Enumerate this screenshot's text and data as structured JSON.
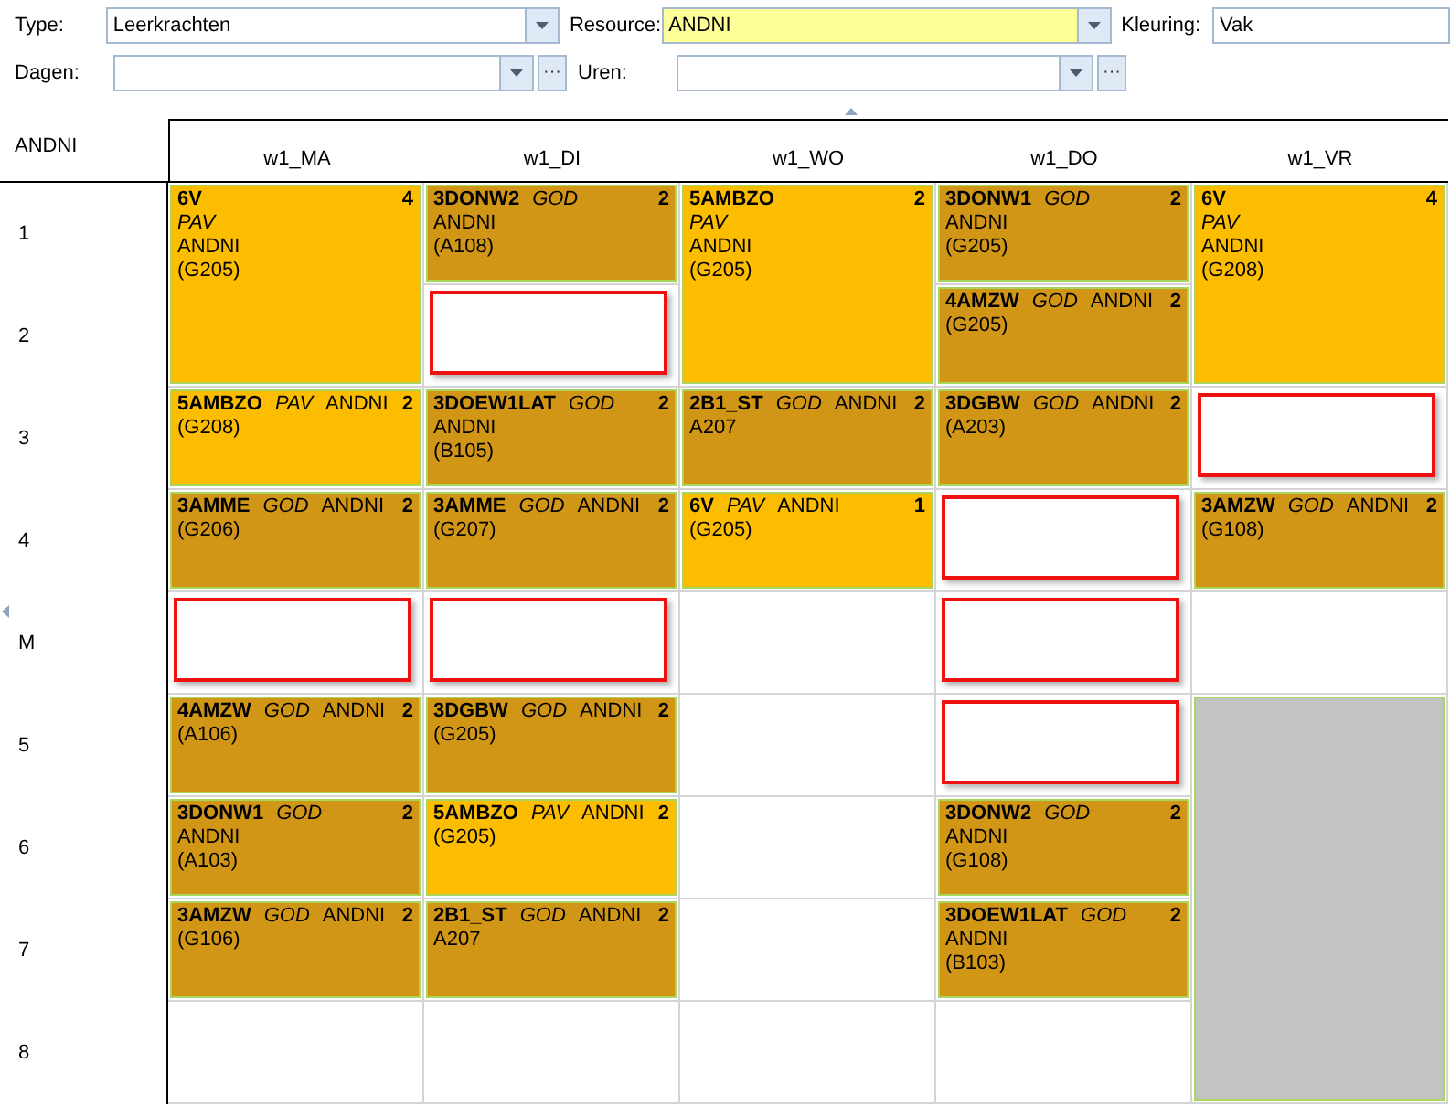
{
  "filters": [
    {
      "label": "Type:",
      "value": "Leerkrachten",
      "kind": "combo",
      "highlighted": false
    },
    {
      "label": "Resource:",
      "value": "ANDNI",
      "kind": "combo",
      "highlighted": true
    },
    {
      "label": "Kleuring:",
      "value": "Vak",
      "kind": "text",
      "highlighted": false
    },
    {
      "label": "Dagen:",
      "kind": "combo",
      "highlighted": false,
      "button": "···"
    },
    {
      "label": "Uren:",
      "kind": "combo",
      "highlighted": false,
      "button": "···"
    }
  ],
  "resource_label": "ANDNI",
  "hours": [
    "1",
    "2",
    "3",
    "4",
    "M",
    "5",
    "6",
    "7",
    "8"
  ],
  "days": [
    {
      "label": "w1_MA",
      "slots": [
        {
          "kind": "lesson",
          "group": "6V",
          "subject": "PAV",
          "teacher": "ANDNI",
          "room": "(G205)",
          "count": "4",
          "color": "#fcbd00"
        },
        {
          "kind": "continued"
        },
        {
          "kind": "lesson",
          "group": "5AMBZO",
          "subject": "PAV",
          "teacher": "ANDNI",
          "room": "(G208)",
          "count": "2",
          "color": "#fcbd00"
        },
        {
          "kind": "lesson",
          "group": "3AMME",
          "subject": "GOD",
          "teacher": "ANDNI",
          "room": "(G206)",
          "count": "2",
          "color": "#d29617"
        },
        {
          "kind": "marked"
        },
        {
          "kind": "lesson",
          "group": "4AMZW",
          "subject": "GOD",
          "teacher": "ANDNI",
          "room": "(A106)",
          "count": "2",
          "color": "#d29617"
        },
        {
          "kind": "lesson",
          "group": "3DONW1",
          "subject": "GOD",
          "teacher": "ANDNI",
          "room": "(A103)",
          "count": "2",
          "color": "#d29617"
        },
        {
          "kind": "lesson",
          "group": "3AMZW",
          "subject": "GOD",
          "teacher": "ANDNI",
          "room": "(G106)",
          "count": "2",
          "color": "#d29617"
        },
        {
          "kind": "empty"
        }
      ]
    },
    {
      "label": "w1_DI",
      "slots": [
        {
          "kind": "lesson",
          "group": "3DONW2",
          "subject": "GOD",
          "teacher": "ANDNI",
          "room": "(A108)",
          "count": "2",
          "color": "#d29617"
        },
        {
          "kind": "marked"
        },
        {
          "kind": "lesson",
          "group": "3DOEW1LAT",
          "subject": "GOD",
          "teacher": "ANDNI",
          "room": "(B105)",
          "count": "2",
          "color": "#d29617"
        },
        {
          "kind": "lesson",
          "group": "3AMME",
          "subject": "GOD",
          "teacher": "ANDNI",
          "room": "(G207)",
          "count": "2",
          "color": "#d29617"
        },
        {
          "kind": "marked"
        },
        {
          "kind": "lesson",
          "group": "3DGBW",
          "subject": "GOD",
          "teacher": "ANDNI",
          "room": "(G205)",
          "count": "2",
          "color": "#d29617"
        },
        {
          "kind": "lesson",
          "group": "5AMBZO",
          "subject": "PAV",
          "teacher": "ANDNI",
          "room": "(G205)",
          "count": "2",
          "color": "#fcbd00"
        },
        {
          "kind": "lesson",
          "group": "2B1_ST",
          "subject": "GOD",
          "teacher": "ANDNI",
          "room": "A207",
          "count": "2",
          "color": "#d29617"
        },
        {
          "kind": "empty"
        }
      ]
    },
    {
      "label": "w1_WO",
      "slots": [
        {
          "kind": "lesson",
          "group": "5AMBZO",
          "subject": "PAV",
          "teacher": "ANDNI",
          "room": "(G205)",
          "count": "2",
          "color": "#fcbd00"
        },
        {
          "kind": "continued"
        },
        {
          "kind": "lesson",
          "group": "2B1_ST",
          "subject": "GOD",
          "teacher": "ANDNI",
          "room": "A207",
          "count": "2",
          "color": "#d29617"
        },
        {
          "kind": "lesson",
          "group": "6V",
          "subject": "PAV",
          "teacher": "ANDNI",
          "room": "(G205)",
          "count": "1",
          "color": "#fcbd00"
        },
        {
          "kind": "empty"
        },
        {
          "kind": "empty"
        },
        {
          "kind": "empty"
        },
        {
          "kind": "empty"
        },
        {
          "kind": "empty"
        }
      ]
    },
    {
      "label": "w1_DO",
      "slots": [
        {
          "kind": "lesson",
          "group": "3DONW1",
          "subject": "GOD",
          "teacher": "ANDNI",
          "room": "(G205)",
          "count": "2",
          "color": "#d29617"
        },
        {
          "kind": "lesson",
          "group": "4AMZW",
          "subject": "GOD",
          "teacher": "ANDNI",
          "room": "(G205)",
          "count": "2",
          "color": "#d29617"
        },
        {
          "kind": "lesson",
          "group": "3DGBW",
          "subject": "GOD",
          "teacher": "ANDNI",
          "room": "(A203)",
          "count": "2",
          "color": "#d29617"
        },
        {
          "kind": "marked"
        },
        {
          "kind": "marked"
        },
        {
          "kind": "marked"
        },
        {
          "kind": "lesson",
          "group": "3DONW2",
          "subject": "GOD",
          "teacher": "ANDNI",
          "room": "(G108)",
          "count": "2",
          "color": "#d29617"
        },
        {
          "kind": "lesson",
          "group": "3DOEW1LAT",
          "subject": "GOD",
          "teacher": "ANDNI",
          "room": "(B103)",
          "count": "2",
          "color": "#d29617"
        },
        {
          "kind": "empty"
        }
      ]
    },
    {
      "label": "w1_VR",
      "slots": [
        {
          "kind": "lesson",
          "group": "6V",
          "subject": "PAV",
          "teacher": "ANDNI",
          "room": "(G208)",
          "count": "4",
          "color": "#fcbd00"
        },
        {
          "kind": "continued"
        },
        {
          "kind": "marked"
        },
        {
          "kind": "lesson",
          "group": "3AMZW",
          "subject": "GOD",
          "teacher": "ANDNI",
          "room": "(G108)",
          "count": "2",
          "color": "#d29617"
        },
        {
          "kind": "empty"
        },
        {
          "kind": "blocked"
        },
        {
          "kind": "continued"
        },
        {
          "kind": "continued"
        },
        {
          "kind": "continued"
        }
      ]
    }
  ]
}
